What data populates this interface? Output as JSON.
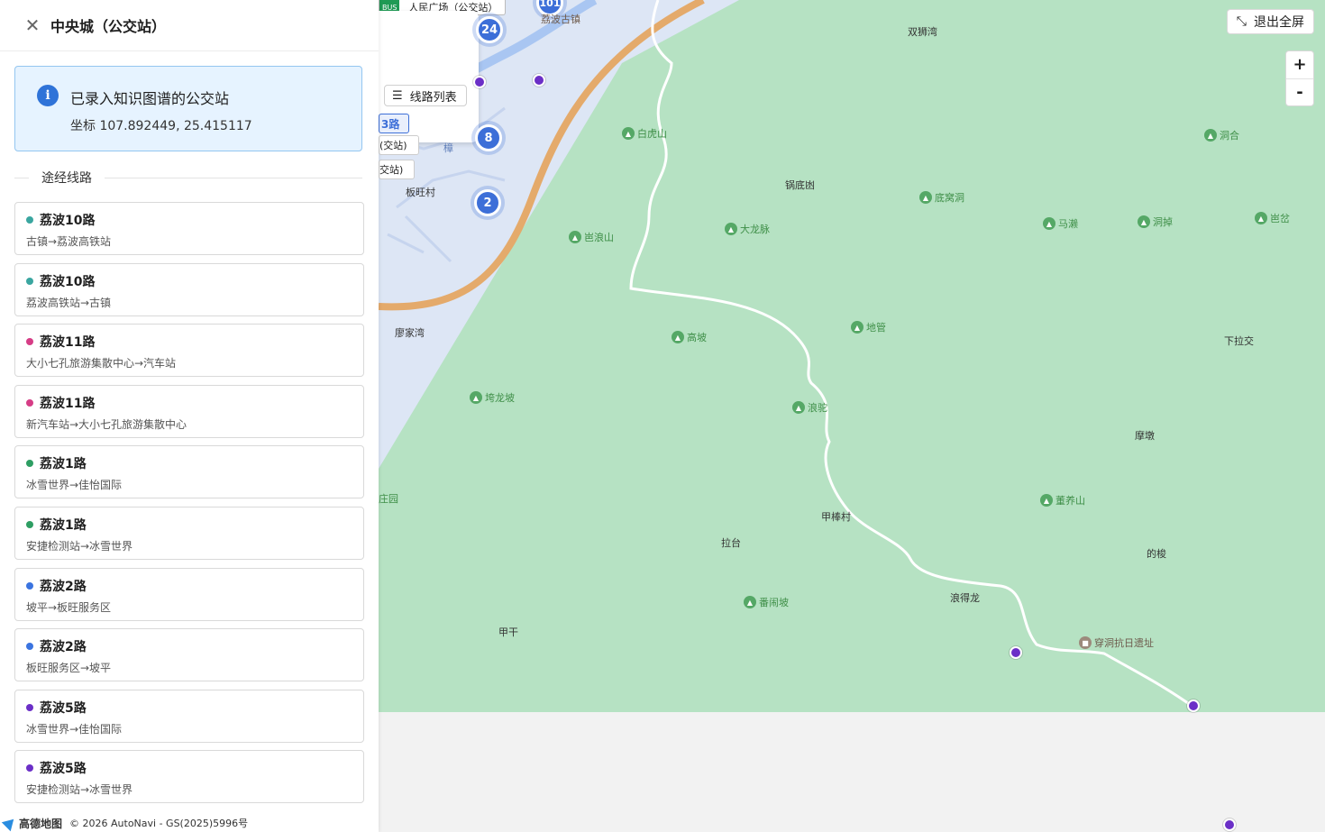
{
  "panel": {
    "title": "中央城（公交站）",
    "info_title": "已录入知识图谱的公交站",
    "info_coord": "坐标 107.892449, 25.415117",
    "section_label": "途经线路",
    "routes": [
      {
        "name": "荔波10路",
        "direction": "古镇→荔波高铁站",
        "color": "#3aa6a0"
      },
      {
        "name": "荔波10路",
        "direction": "荔波高铁站→古镇",
        "color": "#3aa6a0"
      },
      {
        "name": "荔波11路",
        "direction": "大小七孔旅游集散中心→汽车站",
        "color": "#d63d86"
      },
      {
        "name": "荔波11路",
        "direction": "新汽车站→大小七孔旅游集散中心",
        "color": "#d63d86"
      },
      {
        "name": "荔波1路",
        "direction": "冰雪世界→佳怡国际",
        "color": "#2e9e63"
      },
      {
        "name": "荔波1路",
        "direction": "安捷检测站→冰雪世界",
        "color": "#2e9e63"
      },
      {
        "name": "荔波2路",
        "direction": "坡平→板旺服务区",
        "color": "#3b74e0"
      },
      {
        "name": "荔波2路",
        "direction": "板旺服务区→坡平",
        "color": "#3b74e0"
      },
      {
        "name": "荔波5路",
        "direction": "冰雪世界→佳怡国际",
        "color": "#6b2fc7"
      },
      {
        "name": "荔波5路",
        "direction": "安捷检测站→冰雪世界",
        "color": "#6b2fc7"
      }
    ]
  },
  "map": {
    "fullscreen_label": "退出全屏",
    "zoom_in": "+",
    "zoom_out": "-",
    "route_list_label": "线路列表",
    "selected_route": "3路",
    "bus_tag": "BUS",
    "bus_station_label": "人民广场（公交站）",
    "chip_a": "(交站)",
    "chip_b": "交站)",
    "clusters": [
      "101",
      "24",
      "8",
      "2"
    ],
    "places": [
      "双狮湾",
      "锅底凼",
      "廖家湾",
      "板旺村",
      "荔波古镇",
      "下拉交",
      "摩墩",
      "甲棒村",
      "拉台",
      "的梭",
      "浪得龙",
      "甲干",
      "庄园",
      "樟"
    ],
    "pois": [
      "白虎山",
      "底窝洞",
      "洞合",
      "大龙脉",
      "马濑",
      "洞掉",
      "岜岔",
      "岜浪山",
      "地管",
      "高坡",
      "浪驼",
      "垮龙坡",
      "董养山",
      "番闹坡",
      "穿洞抗日遗址"
    ]
  },
  "footer": {
    "logo": "高德地图",
    "copyright": "© 2026 AutoNavi - GS(2025)5996号"
  }
}
